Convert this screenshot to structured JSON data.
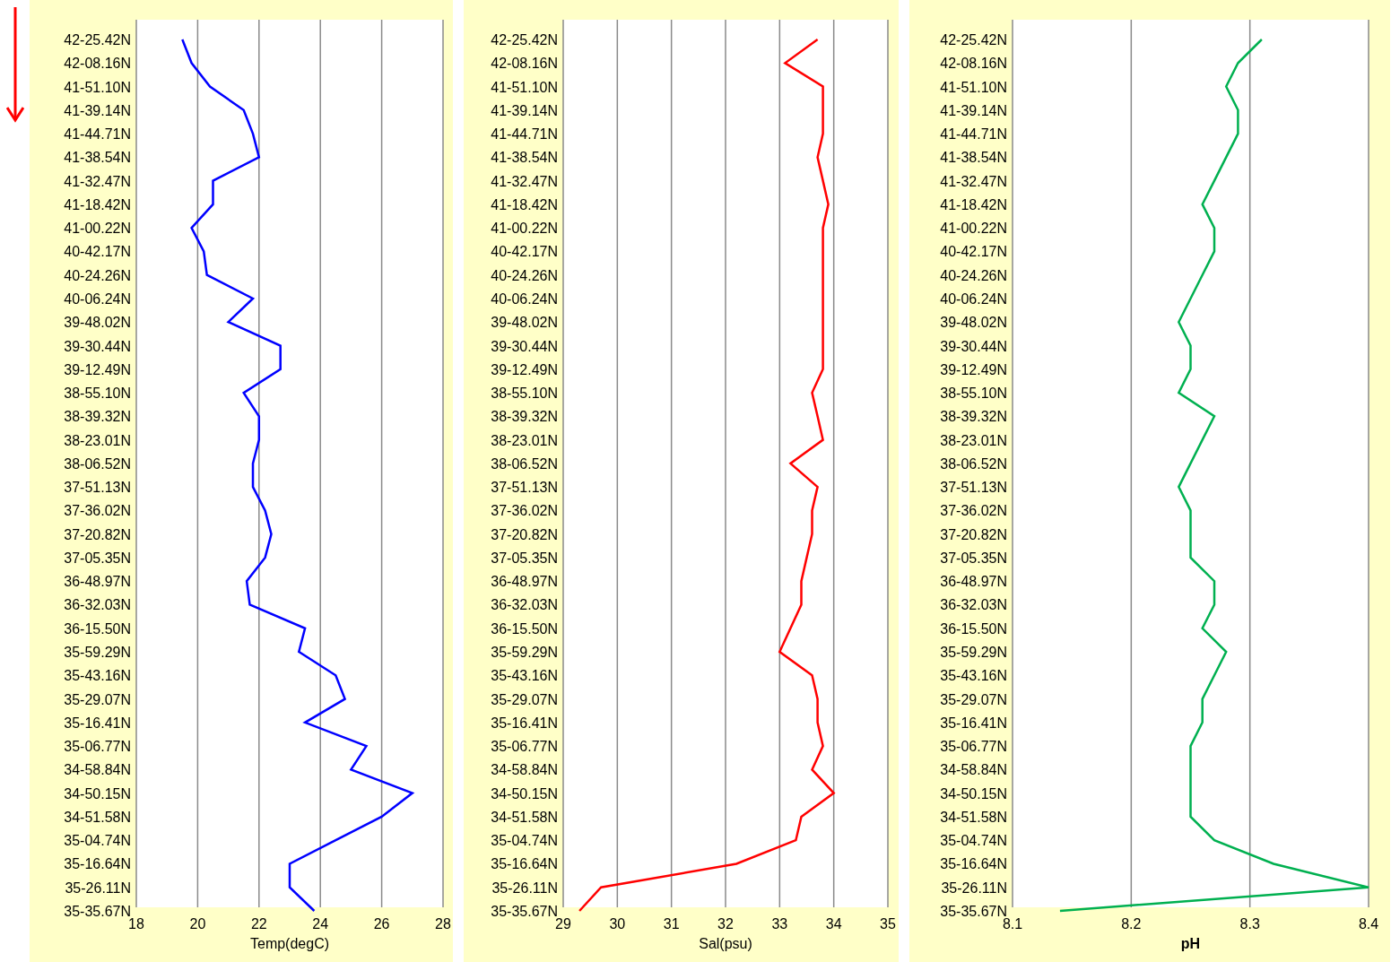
{
  "charts": [
    {
      "chart_data": {
        "type": "line",
        "orientation": "horizontal",
        "xlabel": "Temp(degC)",
        "categories": [
          "42-25.42N",
          "42-08.16N",
          "41-51.10N",
          "41-39.14N",
          "41-44.71N",
          "41-38.54N",
          "41-32.47N",
          "41-18.42N",
          "41-00.22N",
          "40-42.17N",
          "40-24.26N",
          "40-06.24N",
          "39-48.02N",
          "39-30.44N",
          "39-12.49N",
          "38-55.10N",
          "38-39.32N",
          "38-23.01N",
          "38-06.52N",
          "37-51.13N",
          "37-36.02N",
          "37-20.82N",
          "37-05.35N",
          "36-48.97N",
          "36-32.03N",
          "36-15.50N",
          "35-59.29N",
          "35-43.16N",
          "35-29.07N",
          "35-16.41N",
          "35-06.77N",
          "34-58.84N",
          "34-50.15N",
          "34-51.58N",
          "35-04.74N",
          "35-16.64N",
          "35-26.11N",
          "35-35.67N"
        ],
        "xlim": [
          18,
          28
        ],
        "xticks": [
          18,
          20,
          22,
          24,
          26,
          28
        ],
        "grid": true,
        "series": [
          {
            "color": "#0000ff",
            "values": [
              19.5,
              19.8,
              20.4,
              21.5,
              21.8,
              22.0,
              20.5,
              20.5,
              19.8,
              20.2,
              20.3,
              21.8,
              21.0,
              22.7,
              22.7,
              21.5,
              22.0,
              22.0,
              21.8,
              21.8,
              22.2,
              22.4,
              22.2,
              21.6,
              21.7,
              23.5,
              23.3,
              24.5,
              24.8,
              23.5,
              25.5,
              25.0,
              27.0,
              26.0,
              24.5,
              23.0,
              23.0,
              23.8
            ]
          }
        ]
      }
    },
    {
      "chart_data": {
        "type": "line",
        "orientation": "horizontal",
        "xlabel": "Sal(psu)",
        "categories": [
          "42-25.42N",
          "42-08.16N",
          "41-51.10N",
          "41-39.14N",
          "41-44.71N",
          "41-38.54N",
          "41-32.47N",
          "41-18.42N",
          "41-00.22N",
          "40-42.17N",
          "40-24.26N",
          "40-06.24N",
          "39-48.02N",
          "39-30.44N",
          "39-12.49N",
          "38-55.10N",
          "38-39.32N",
          "38-23.01N",
          "38-06.52N",
          "37-51.13N",
          "37-36.02N",
          "37-20.82N",
          "37-05.35N",
          "36-48.97N",
          "36-32.03N",
          "36-15.50N",
          "35-59.29N",
          "35-43.16N",
          "35-29.07N",
          "35-16.41N",
          "35-06.77N",
          "34-58.84N",
          "34-50.15N",
          "34-51.58N",
          "35-04.74N",
          "35-16.64N",
          "35-26.11N",
          "35-35.67N"
        ],
        "xlim": [
          29,
          35
        ],
        "xticks": [
          29,
          30,
          31,
          32,
          33,
          34,
          35
        ],
        "grid": true,
        "series": [
          {
            "color": "#ff0000",
            "values": [
              33.7,
              33.1,
              33.8,
              33.8,
              33.8,
              33.7,
              33.8,
              33.9,
              33.8,
              33.8,
              33.8,
              33.8,
              33.8,
              33.8,
              33.8,
              33.6,
              33.7,
              33.8,
              33.2,
              33.7,
              33.6,
              33.6,
              33.5,
              33.4,
              33.4,
              33.2,
              33.0,
              33.6,
              33.7,
              33.7,
              33.8,
              33.6,
              34.0,
              33.4,
              33.3,
              32.2,
              29.7,
              29.3
            ]
          }
        ]
      }
    },
    {
      "chart_data": {
        "type": "line",
        "orientation": "horizontal",
        "xlabel": "pH",
        "categories": [
          "42-25.42N",
          "42-08.16N",
          "41-51.10N",
          "41-39.14N",
          "41-44.71N",
          "41-38.54N",
          "41-32.47N",
          "41-18.42N",
          "41-00.22N",
          "40-42.17N",
          "40-24.26N",
          "40-06.24N",
          "39-48.02N",
          "39-30.44N",
          "39-12.49N",
          "38-55.10N",
          "38-39.32N",
          "38-23.01N",
          "38-06.52N",
          "37-51.13N",
          "37-36.02N",
          "37-20.82N",
          "37-05.35N",
          "36-48.97N",
          "36-32.03N",
          "36-15.50N",
          "35-59.29N",
          "35-43.16N",
          "35-29.07N",
          "35-16.41N",
          "35-06.77N",
          "34-58.84N",
          "34-50.15N",
          "34-51.58N",
          "35-04.74N",
          "35-16.64N",
          "35-26.11N",
          "35-35.67N"
        ],
        "xlim": [
          8.1,
          8.4
        ],
        "xticks": [
          8.1,
          8.2,
          8.3,
          8.4
        ],
        "grid": true,
        "series": [
          {
            "color": "#00b050",
            "values": [
              8.31,
              8.29,
              8.28,
              8.29,
              8.29,
              8.28,
              8.27,
              8.26,
              8.27,
              8.27,
              8.26,
              8.25,
              8.24,
              8.25,
              8.25,
              8.24,
              8.27,
              8.26,
              8.25,
              8.24,
              8.25,
              8.25,
              8.25,
              8.27,
              8.27,
              8.26,
              8.28,
              8.27,
              8.26,
              8.26,
              8.25,
              8.25,
              8.25,
              8.25,
              8.27,
              8.32,
              8.4,
              8.14
            ]
          }
        ]
      }
    }
  ]
}
